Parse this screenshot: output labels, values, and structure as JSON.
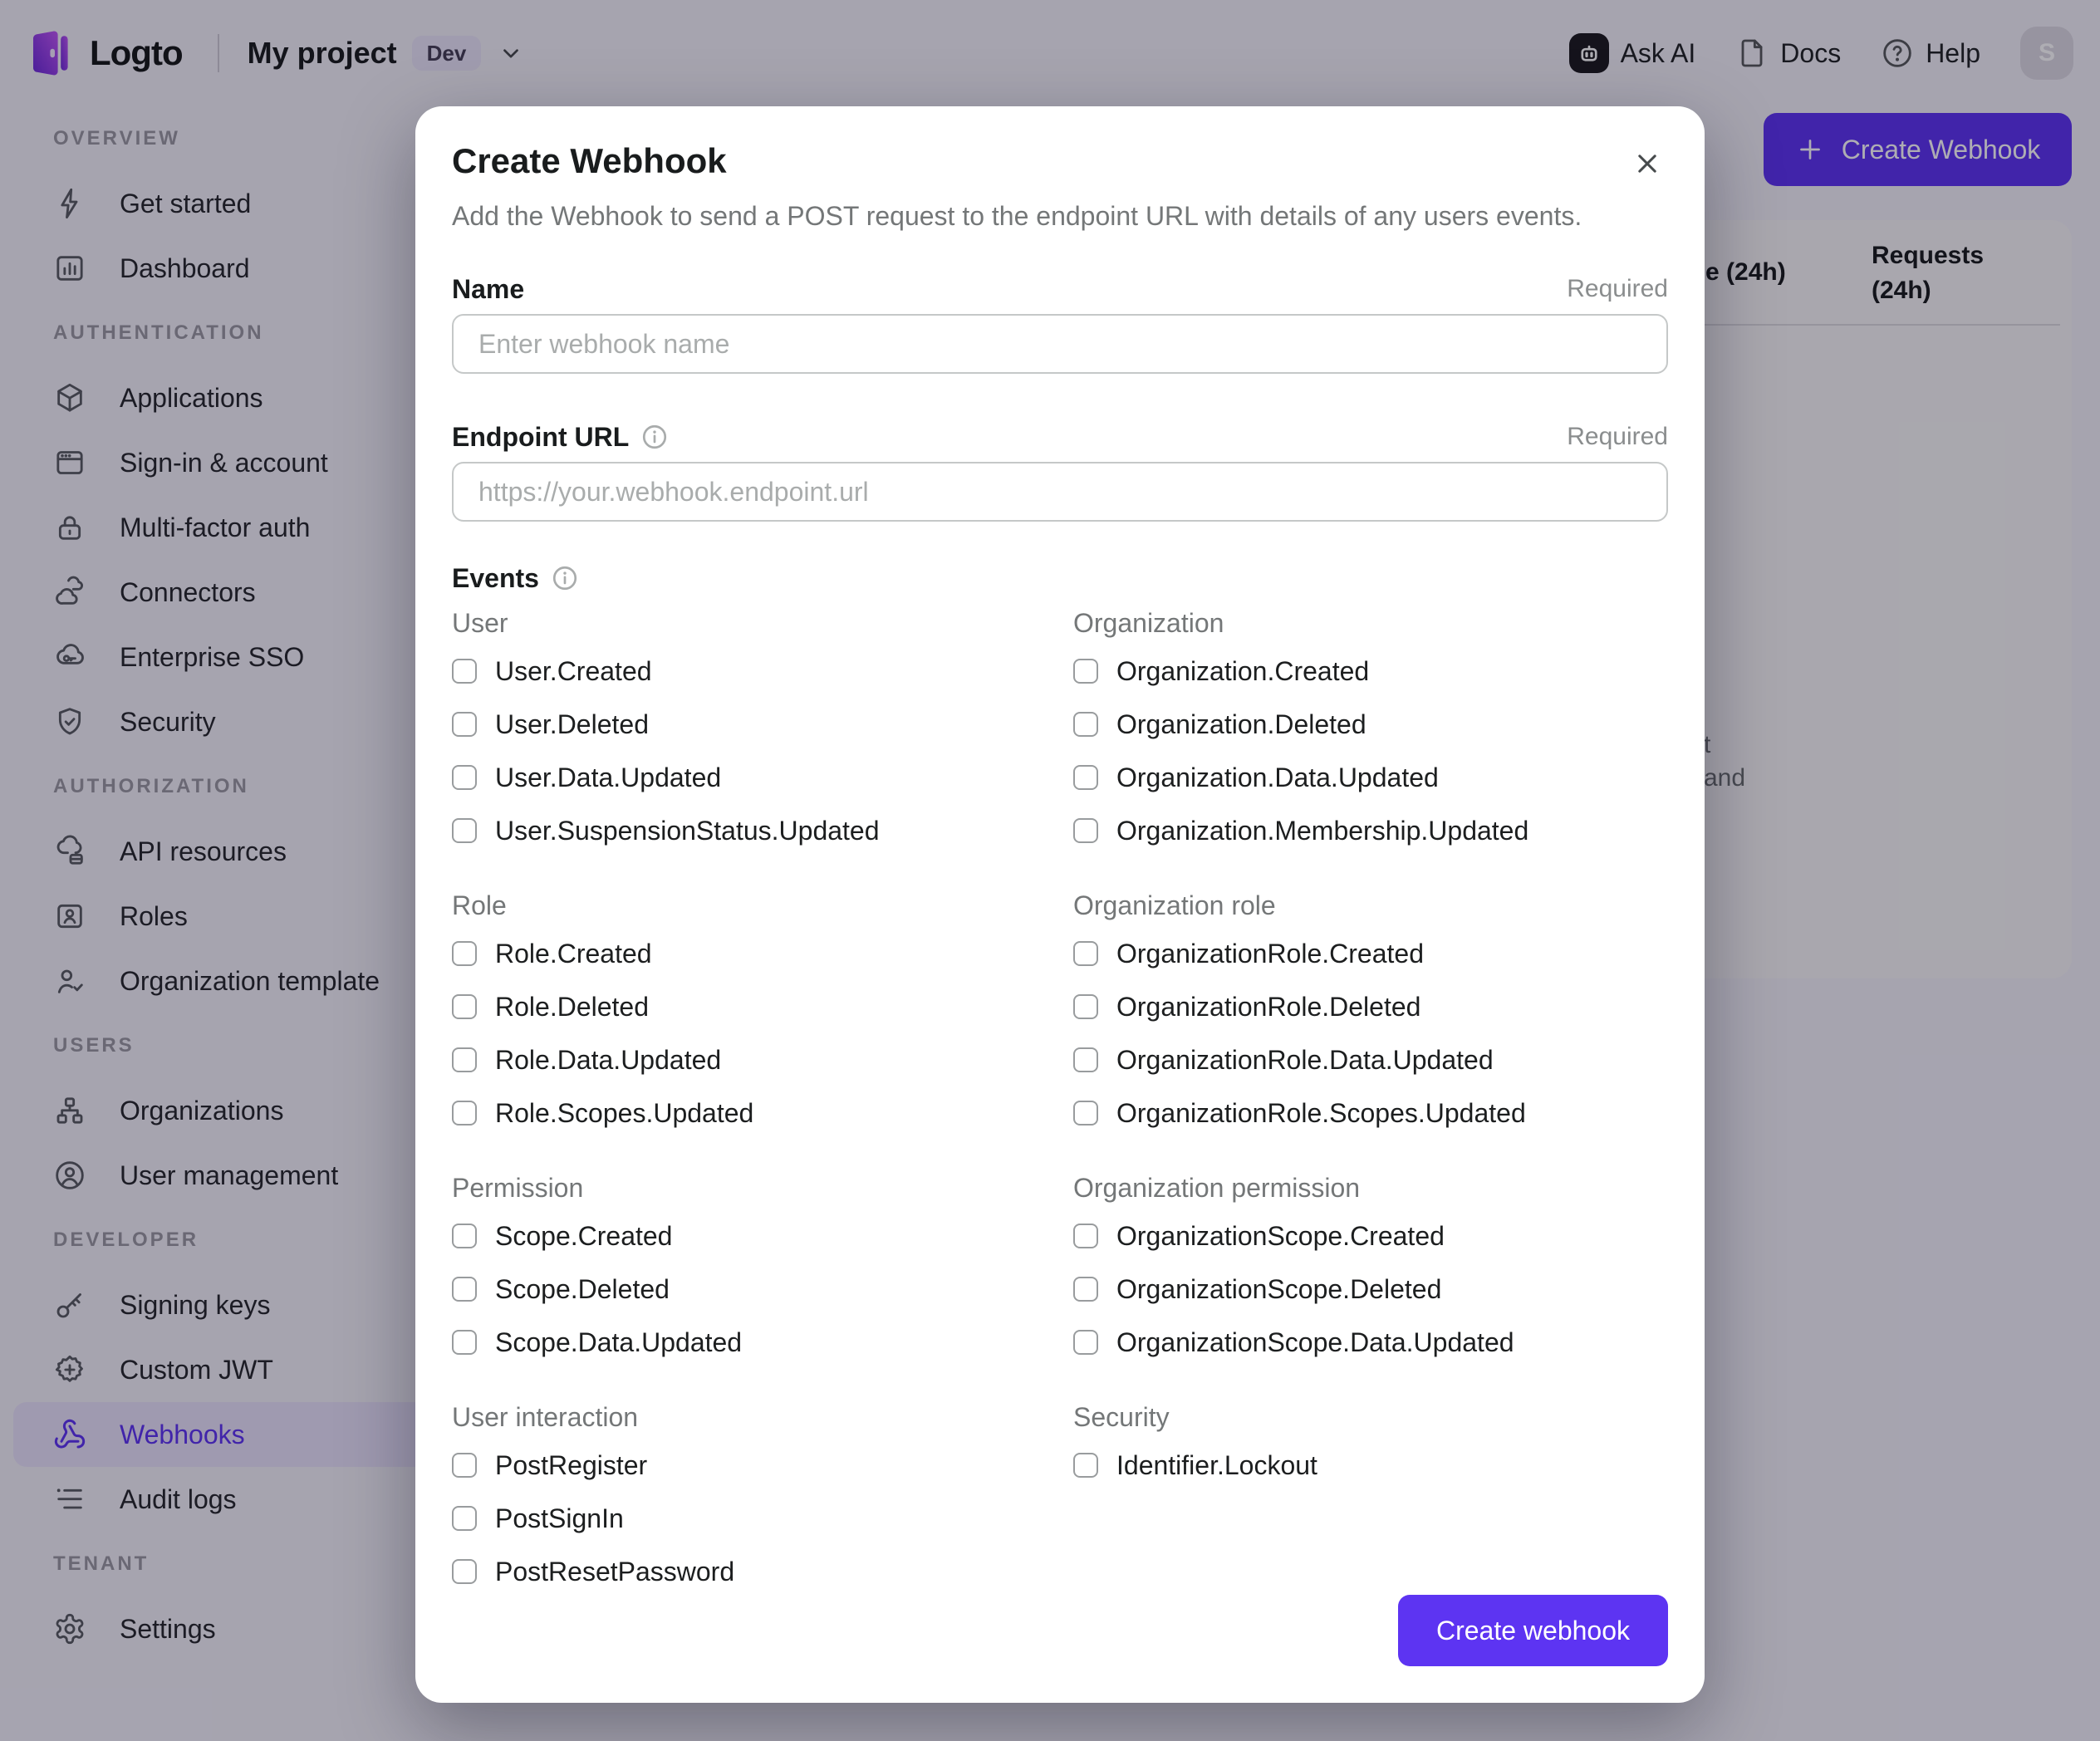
{
  "header": {
    "logo_text": "Logto",
    "project_name": "My project",
    "env_badge": "Dev",
    "ask_ai_label": "Ask AI",
    "docs_label": "Docs",
    "help_label": "Help",
    "avatar_initial": "S"
  },
  "sidebar": {
    "sections": [
      {
        "label": "OVERVIEW",
        "items": [
          {
            "label": "Get started"
          },
          {
            "label": "Dashboard"
          }
        ]
      },
      {
        "label": "AUTHENTICATION",
        "items": [
          {
            "label": "Applications"
          },
          {
            "label": "Sign-in & account"
          },
          {
            "label": "Multi-factor auth"
          },
          {
            "label": "Connectors"
          },
          {
            "label": "Enterprise SSO"
          },
          {
            "label": "Security"
          }
        ]
      },
      {
        "label": "AUTHORIZATION",
        "items": [
          {
            "label": "API resources"
          },
          {
            "label": "Roles"
          },
          {
            "label": "Organization template"
          }
        ]
      },
      {
        "label": "USERS",
        "items": [
          {
            "label": "Organizations"
          },
          {
            "label": "User management"
          }
        ]
      },
      {
        "label": "DEVELOPER",
        "items": [
          {
            "label": "Signing keys"
          },
          {
            "label": "Custom JWT"
          },
          {
            "label": "Webhooks"
          },
          {
            "label": "Audit logs"
          }
        ]
      },
      {
        "label": "TENANT",
        "items": [
          {
            "label": "Settings"
          }
        ]
      }
    ]
  },
  "background": {
    "create_button_label": "Create Webhook",
    "table": {
      "success_rate_fragment": "e (24h)",
      "requests_header": "Requests (24h)",
      "empty_fragment_line1": "t",
      "empty_fragment_line2": "and"
    }
  },
  "modal": {
    "title": "Create Webhook",
    "description": "Add the Webhook to send a POST request to the endpoint URL with details of any users events.",
    "required": "Required",
    "name_field": {
      "label": "Name",
      "placeholder": "Enter webhook name"
    },
    "endpoint_field": {
      "label": "Endpoint URL",
      "placeholder": "https://your.webhook.endpoint.url"
    },
    "events_label": "Events",
    "events": {
      "groups": [
        {
          "title": "User",
          "items": [
            "User.Created",
            "User.Deleted",
            "User.Data.Updated",
            "User.SuspensionStatus.Updated"
          ]
        },
        {
          "title": "Organization",
          "items": [
            "Organization.Created",
            "Organization.Deleted",
            "Organization.Data.Updated",
            "Organization.Membership.Updated"
          ]
        },
        {
          "title": "Role",
          "items": [
            "Role.Created",
            "Role.Deleted",
            "Role.Data.Updated",
            "Role.Scopes.Updated"
          ]
        },
        {
          "title": "Organization role",
          "items": [
            "OrganizationRole.Created",
            "OrganizationRole.Deleted",
            "OrganizationRole.Data.Updated",
            "OrganizationRole.Scopes.Updated"
          ]
        },
        {
          "title": "Permission",
          "items": [
            "Scope.Created",
            "Scope.Deleted",
            "Scope.Data.Updated"
          ]
        },
        {
          "title": "Organization permission",
          "items": [
            "OrganizationScope.Created",
            "OrganizationScope.Deleted",
            "OrganizationScope.Data.Updated"
          ]
        },
        {
          "title": "User interaction",
          "items": [
            "PostRegister",
            "PostSignIn",
            "PostResetPassword"
          ]
        },
        {
          "title": "Security",
          "items": [
            "Identifier.Lockout"
          ]
        }
      ]
    },
    "submit_label": "Create webhook"
  },
  "colors": {
    "accent": "#5d34f2",
    "accent_light": "#e9e3fb",
    "text_primary": "#191c1d",
    "text_secondary": "#747778"
  }
}
